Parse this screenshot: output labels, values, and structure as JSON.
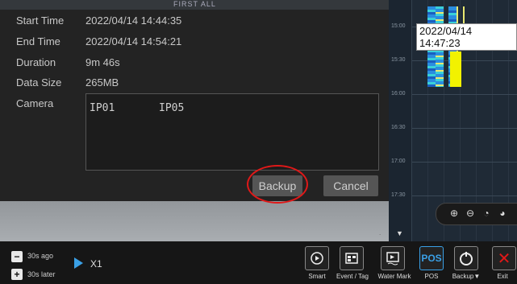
{
  "video": {
    "top_text": "FIRST ALL"
  },
  "info": {
    "rows": [
      {
        "label": "Start Time",
        "value": "2022/04/14 14:44:35"
      },
      {
        "label": "End Time",
        "value": "2022/04/14 14:54:21"
      },
      {
        "label": "Duration",
        "value": "9m 46s"
      },
      {
        "label": "Data Size",
        "value": "265MB"
      },
      {
        "label": "Camera",
        "value": ""
      }
    ],
    "cameras": [
      "IP01",
      "IP05"
    ]
  },
  "dialog_buttons": {
    "backup": "Backup",
    "cancel": "Cancel"
  },
  "timeline": {
    "labels": [
      "15:00",
      "15:30",
      "16:00",
      "16:30",
      "17:00",
      "17:30"
    ],
    "tooltip": "2022/04/14 14:47:23"
  },
  "controls": {
    "back_label": "30s ago",
    "forward_label": "30s later",
    "speed": "X1",
    "minus": "−",
    "plus": "+"
  },
  "toolbar": [
    {
      "label": "Smart",
      "icon": "smart-search-icon"
    },
    {
      "label": "Event / Tag",
      "icon": "event-tag-icon"
    },
    {
      "label": "Water Mark",
      "icon": "watermark-icon"
    },
    {
      "label": "POS",
      "icon": "pos-icon",
      "icon_text": "POS"
    },
    {
      "label": "Backup▼",
      "icon": "backup-icon"
    },
    {
      "label": "Exit",
      "icon": "exit-icon"
    }
  ],
  "colors": {
    "accent": "#3aa0e6",
    "highlight": "#e01818",
    "timeline_bg": "#1f2a36",
    "rec_yellow": "#f2f200"
  }
}
